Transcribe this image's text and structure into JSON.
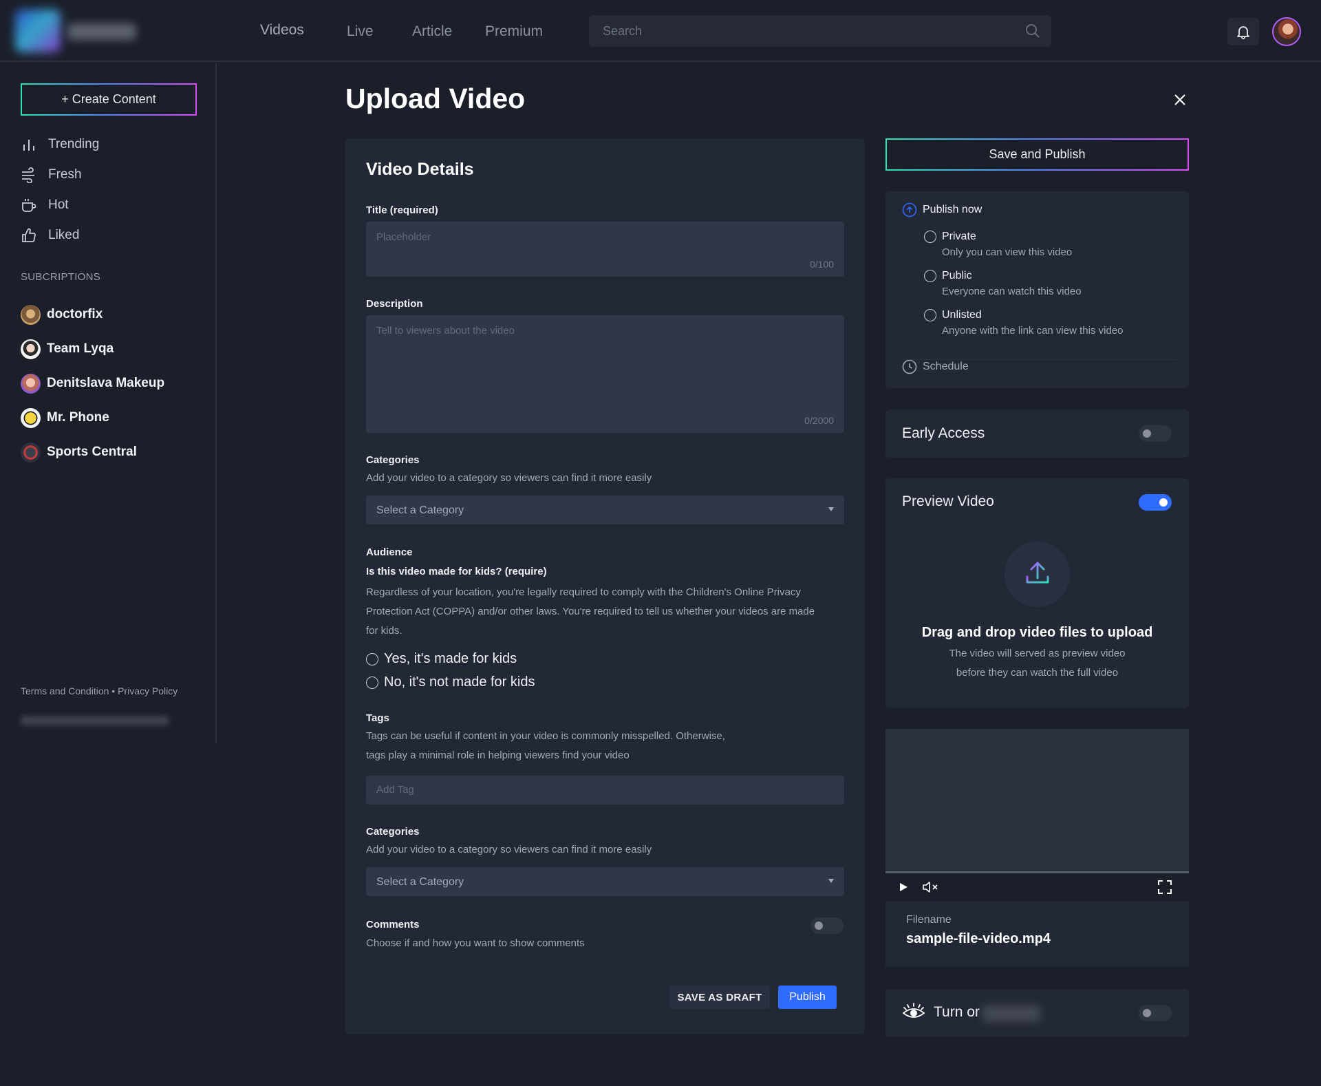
{
  "header": {
    "nav": [
      "Videos",
      "Live",
      "Article",
      "Premium"
    ],
    "search_placeholder": "Search"
  },
  "sidebar": {
    "create_label": "+ Create Content",
    "items": [
      {
        "label": "Trending",
        "icon": "bar-chart-icon"
      },
      {
        "label": "Fresh",
        "icon": "wind-icon"
      },
      {
        "label": "Hot",
        "icon": "coffee-cup-icon"
      },
      {
        "label": "Liked",
        "icon": "thumbs-up-icon"
      }
    ],
    "subscriptions_title": "SUBCRIPTIONS",
    "subscriptions": [
      {
        "name": "doctorfix"
      },
      {
        "name": "Team Lyqa"
      },
      {
        "name": "Denitslava Makeup"
      },
      {
        "name": "Mr. Phone"
      },
      {
        "name": "Sports Central"
      }
    ],
    "footer": {
      "terms": "Terms and Condition",
      "sep": "•",
      "privacy": "Privacy Policy"
    }
  },
  "page": {
    "title": "Upload Video"
  },
  "details": {
    "heading": "Video Details",
    "title_label": "Title (required)",
    "title_placeholder": "Placeholder",
    "title_counter": "0/100",
    "description_label": "Description",
    "description_placeholder": "Tell to viewers about the video",
    "description_counter": "0/2000",
    "categories1": {
      "label": "Categories",
      "help": "Add your video to a category so viewers can find it more easily",
      "select": "Select a Category"
    },
    "audience": {
      "label": "Audience",
      "question": "Is this video made for kids? (require)",
      "help_lines": [
        "Regardless of your location, you're legally required to comply with the Children's Online Privacy",
        "Protection Act (COPPA) and/or other laws. You're required to tell us whether your videos are made",
        "for kids."
      ],
      "option_yes": "Yes, it's made for kids",
      "option_no": "No, it's not made for kids"
    },
    "tags": {
      "label": "Tags",
      "help_lines": [
        "Tags can be useful if content in your video is commonly misspelled. Otherwise,",
        "tags play a minimal role in helping viewers find your video"
      ],
      "placeholder": "Add Tag"
    },
    "categories2": {
      "label": "Categories",
      "help": "Add your video to a category so viewers can find it more easily",
      "select": "Select a Category"
    },
    "comments": {
      "label": "Comments",
      "help": "Choose if and how you want to show comments",
      "enabled": false
    },
    "draft_label": "SAVE AS DRAFT",
    "publish_label": "Publish"
  },
  "right": {
    "save_publish_label": "Save and Publish",
    "publish_now": "Publish now",
    "visibility": [
      {
        "title": "Private",
        "desc": "Only you can view this video"
      },
      {
        "title": "Public",
        "desc": "Everyone can watch this video"
      },
      {
        "title": "Unlisted",
        "desc": "Anyone with the link can view this video"
      }
    ],
    "schedule": "Schedule",
    "early_access": {
      "label": "Early Access",
      "enabled": false
    },
    "preview": {
      "label": "Preview Video",
      "enabled": true,
      "drag_title": "Drag and drop video files to upload",
      "drag_sub1": "The video will served as preview video",
      "drag_sub2": "before they can watch the full video"
    },
    "filename_label": "Filename",
    "filename_value": "sample-file-video.mp4",
    "turn_label": "Turn or",
    "turn_enabled": false
  },
  "colors": {
    "accent": "#2f6bff",
    "bg": "#1b1f2a",
    "card": "#232836"
  }
}
